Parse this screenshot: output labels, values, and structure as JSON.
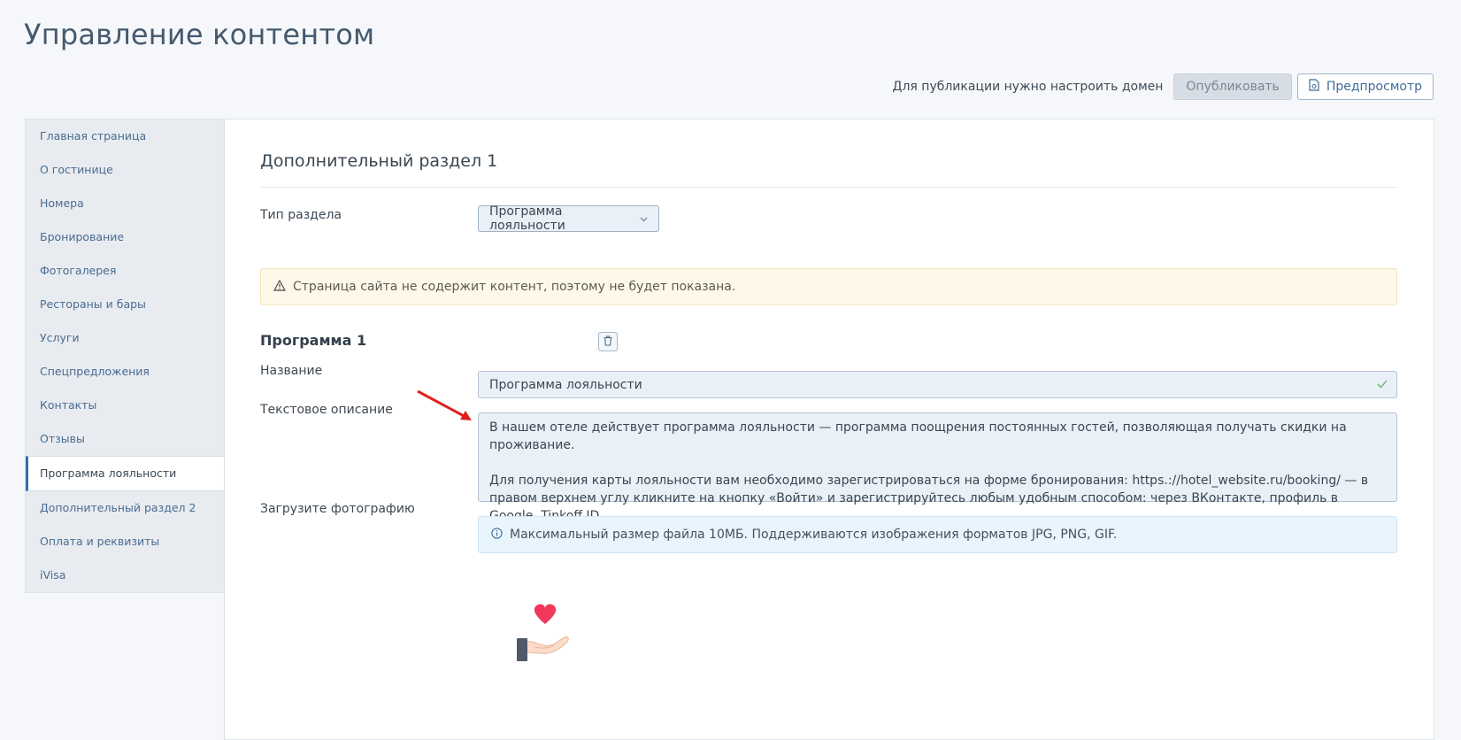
{
  "page": {
    "title": "Управление контентом"
  },
  "topbar": {
    "note": "Для публикации нужно настроить домен",
    "publish_label": "Опубликовать",
    "preview_label": "Предпросмотр"
  },
  "sidebar": {
    "items": [
      {
        "label": "Главная страница"
      },
      {
        "label": "О гостинице"
      },
      {
        "label": "Номера"
      },
      {
        "label": "Бронирование"
      },
      {
        "label": "Фотогалерея"
      },
      {
        "label": "Рестораны и бары"
      },
      {
        "label": "Услуги"
      },
      {
        "label": "Спецпредложения"
      },
      {
        "label": "Контакты"
      },
      {
        "label": "Отзывы"
      },
      {
        "label": "Программа лояльности",
        "active": true
      },
      {
        "label": "Дополнительный раздел 2"
      },
      {
        "label": "Оплата и реквизиты"
      },
      {
        "label": "iVisa"
      }
    ]
  },
  "main": {
    "heading": "Дополнительный раздел 1",
    "section_type": {
      "label": "Тип раздела",
      "value": "Программа лояльности"
    },
    "warning": "Страница сайта не содержит контент, поэтому не будет показана.",
    "program": {
      "title": "Программа 1",
      "name_label": "Название",
      "name_value": "Программа лояльности",
      "description_label": "Текстовое описание",
      "description_p1": "В нашем отеле действует программа лояльности — программа поощрения постоянных гостей, позволяющая получать скидки на проживание.",
      "description_p2": "Для получения карты лояльности вам необходимо зарегистрироваться на форме бронирования: https.://hotel_website.ru/booking/ — в правом верхнем углу кликните на кнопку «Войти» и зарегистрируйтесь любым удобным способом: через ВКонтакте, профиль в Google, Tinkoff ID.",
      "photo_label": "Загрузите фотографию",
      "photo_info": "Максимальный размер файла 10МБ. Поддерживаются изображения форматов JPG, PNG, GIF."
    }
  },
  "colors": {
    "accent": "#2e6fb2",
    "heart": "#f2385a",
    "annotation_arrow": "#e0201f"
  },
  "icons": [
    "preview-icon",
    "chevron-down-icon",
    "warning-icon",
    "trash-icon",
    "check-icon",
    "info-icon",
    "hand-heart-icon"
  ]
}
